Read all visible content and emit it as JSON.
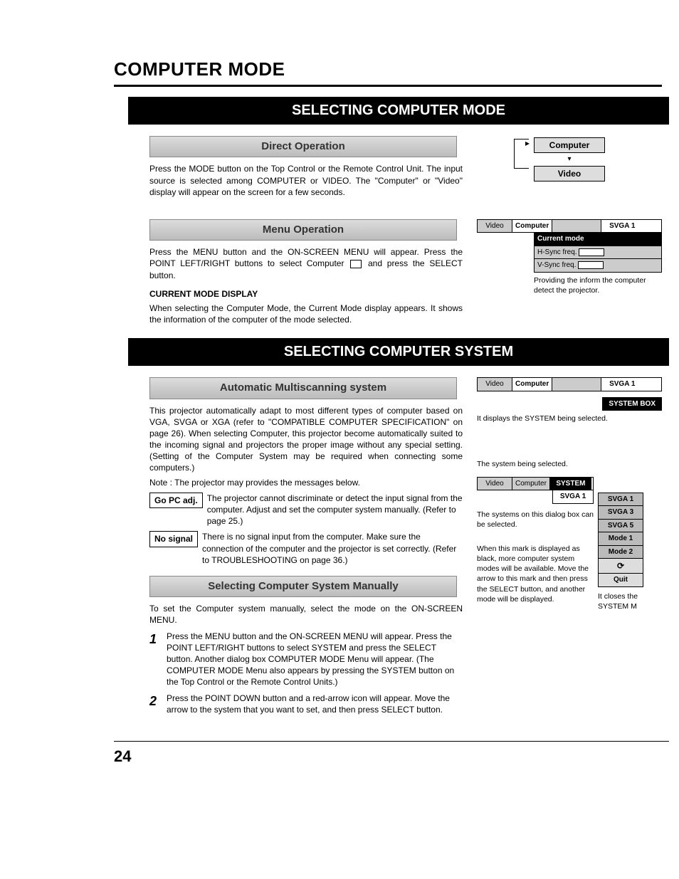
{
  "page": {
    "title": "COMPUTER MODE",
    "number": "24"
  },
  "section1": {
    "banner": "SELECTING COMPUTER MODE",
    "direct": {
      "heading": "Direct Operation",
      "body": "Press the MODE button on the Top Control or the Remote Control Unit. The input source is selected among COMPUTER or VIDEO. The \"Computer\" or \"Video\" display will appear on the screen for a few seconds."
    },
    "menu": {
      "heading": "Menu Operation",
      "body1": "Press the MENU button and the ON-SCREEN MENU will appear. Press the POINT LEFT/RIGHT buttons to select Computer",
      "body1b": "and press the SELECT button.",
      "subhead": "CURRENT MODE DISPLAY",
      "body2": "When selecting the Computer Mode, the Current Mode display appears. It shows the information of the computer of the mode selected."
    },
    "fig": {
      "btn1": "Computer",
      "btn2": "Video",
      "menubar_video": "Video",
      "menubar_computer": "Computer",
      "menubar_svga": "SVGA 1",
      "currentmode": "Current mode",
      "hsync": "H-Sync freq.",
      "vsync": "V-Sync freq.",
      "caption": "Providing the inform the computer detect the projector."
    }
  },
  "section2": {
    "banner": "SELECTING COMPUTER SYSTEM",
    "auto": {
      "heading": "Automatic Multiscanning system",
      "body": "This projector automatically adapt to most different types of computer based on VGA, SVGA or XGA (refer to \"COMPATIBLE COMPUTER SPECIFICATION\" on page 26). When selecting Computer, this projector become automatically suited to the incoming signal and projectors the proper image without any special setting. (Setting of the Computer System may be required when connecting some computers.)",
      "note": "Note : The projector may provides the messages below.",
      "msg1_label": "Go PC adj.",
      "msg1_body": "The projector cannot discriminate or detect the input signal from the computer. Adjust and set the computer system manually. (Refer to page 25.)",
      "msg2_label": "No signal",
      "msg2_body": "There is no signal input from the computer. Make sure the connection of the computer and the projector is set correctly. (Refer to TROUBLESHOOTING on page 36.)"
    },
    "manual": {
      "heading": "Selecting Computer System Manually",
      "intro": "To set the Computer system manually, select the mode on the ON-SCREEN MENU.",
      "step1_num": "1",
      "step1": "Press the MENU button and the ON-SCREEN MENU will appear. Press the POINT LEFT/RIGHT buttons to select SYSTEM and press the SELECT button. Another dialog box COMPUTER MODE Menu will appear. (The COMPUTER MODE Menu also appears by pressing the SYSTEM button on the Top Control or the Remote Control Units.)",
      "step2_num": "2",
      "step2": "Press the POINT DOWN button and a red-arrow icon will appear. Move the arrow to the system that you want to set, and then press SELECT button."
    },
    "fig2": {
      "menubar_video": "Video",
      "menubar_computer": "Computer",
      "menubar_svga": "SVGA 1",
      "systembox": "SYSTEM BOX",
      "caption1": "It displays the SYSTEM being selected.",
      "label_top": "The system being selected.",
      "menubar_system": "SYSTEM",
      "list": [
        "SVGA 1",
        "SVGA 3",
        "SVGA 5",
        "Mode 1",
        "Mode 2"
      ],
      "circle": "⟳",
      "quit": "Quit",
      "note_left": "The systems on this dialog box can be selected.",
      "note_bottom": "When this mark is displayed as black, more computer system modes will be available. Move the arrow to this mark and then press the SELECT button, and another mode will be displayed.",
      "note_right": "It closes the SYSTEM M"
    }
  }
}
